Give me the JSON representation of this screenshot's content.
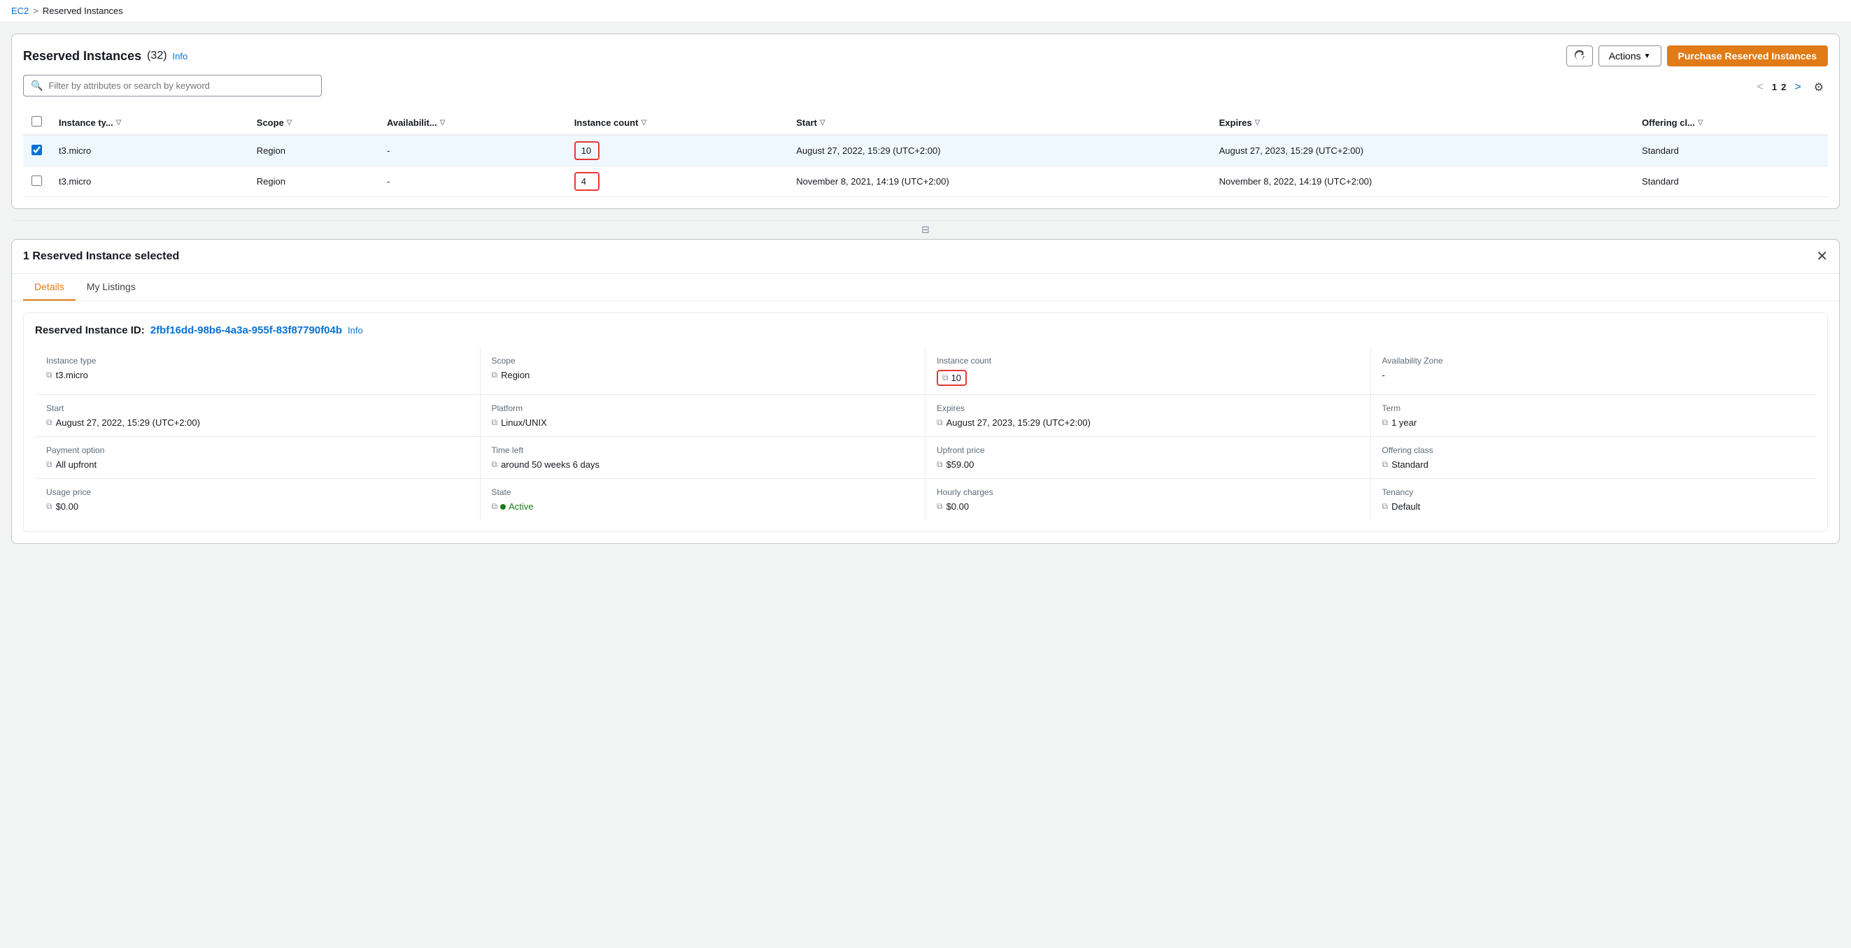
{
  "breadcrumb": {
    "ec2": "EC2",
    "separator": ">",
    "current": "Reserved Instances"
  },
  "header": {
    "title": "Reserved Instances",
    "count": "(32)",
    "info": "Info"
  },
  "toolbar": {
    "refresh_title": "Refresh",
    "actions_label": "Actions",
    "purchase_label": "Purchase Reserved Instances"
  },
  "search": {
    "placeholder": "Filter by attributes or search by keyword"
  },
  "pagination": {
    "prev": "<",
    "page1": "1",
    "page2": "2",
    "next": ">"
  },
  "table": {
    "columns": [
      "Instance ty...",
      "Scope",
      "Availabilit...",
      "Instance count",
      "Start",
      "Expires",
      "Offering cl..."
    ],
    "rows": [
      {
        "selected": true,
        "instance_type": "t3.micro",
        "scope": "Region",
        "availability": "-",
        "instance_count": "10",
        "start": "August 27, 2022, 15:29 (UTC+2:00)",
        "expires": "August 27, 2023, 15:29 (UTC+2:00)",
        "offering_class": "Standard"
      },
      {
        "selected": false,
        "instance_type": "t3.micro",
        "scope": "Region",
        "availability": "-",
        "instance_count": "4",
        "start": "November 8, 2021, 14:19 (UTC+2:00)",
        "expires": "November 8, 2022, 14:19 (UTC+2:00)",
        "offering_class": "Standard"
      }
    ]
  },
  "detail_panel": {
    "title": "1 Reserved Instance selected",
    "tabs": [
      "Details",
      "My Listings"
    ],
    "active_tab": "Details",
    "instance_id_label": "Reserved Instance ID:",
    "instance_id_value": "2fbf16dd-98b6-4a3a-955f-83f87790f04b",
    "info": "Info",
    "fields": {
      "instance_type_label": "Instance type",
      "instance_type_value": "t3.micro",
      "scope_label": "Scope",
      "scope_value": "Region",
      "instance_count_label": "Instance count",
      "instance_count_value": "10",
      "availability_zone_label": "Availability Zone",
      "availability_zone_value": "-",
      "start_label": "Start",
      "start_value": "August 27, 2022, 15:29 (UTC+2:00)",
      "platform_label": "Platform",
      "platform_value": "Linux/UNIX",
      "expires_label": "Expires",
      "expires_value": "August 27, 2023, 15:29 (UTC+2:00)",
      "term_label": "Term",
      "term_value": "1 year",
      "payment_option_label": "Payment option",
      "payment_option_value": "All upfront",
      "time_left_label": "Time left",
      "time_left_value": "around 50 weeks 6 days",
      "upfront_price_label": "Upfront price",
      "upfront_price_value": "$59.00",
      "offering_class_label": "Offering class",
      "offering_class_value": "Standard",
      "usage_price_label": "Usage price",
      "usage_price_value": "$0.00",
      "state_label": "State",
      "state_value": "Active",
      "hourly_charges_label": "Hourly charges",
      "hourly_charges_value": "$0.00",
      "tenancy_label": "Tenancy",
      "tenancy_value": "Default"
    }
  }
}
